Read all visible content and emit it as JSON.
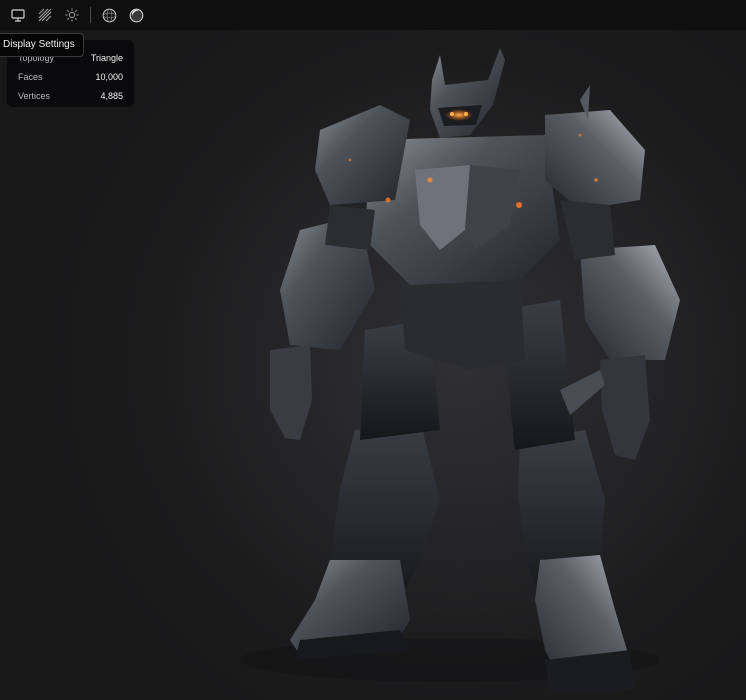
{
  "toolbar": {
    "buttons": [
      {
        "name": "display-settings-button",
        "icon": "monitor-icon"
      },
      {
        "name": "wireframe-button",
        "icon": "hatch-icon"
      },
      {
        "name": "lighting-button",
        "icon": "sun-icon"
      },
      {
        "name": "matcap-button",
        "icon": "wire-sphere-icon"
      },
      {
        "name": "material-button",
        "icon": "shaded-sphere-icon"
      }
    ],
    "tooltip": "Display Settings"
  },
  "stats": {
    "topology_label": "Topology",
    "topology_value": "Triangle",
    "faces_label": "Faces",
    "faces_value": "10,000",
    "vertices_label": "Vertices",
    "vertices_value": "4,885"
  },
  "colors": {
    "background": "#1a1a1b",
    "toolbar": "#0f0f10",
    "panel": "#0a0a0b",
    "accent_glow": "#ff8a2a"
  },
  "viewport": {
    "model": "robot-mech-3d-model"
  }
}
